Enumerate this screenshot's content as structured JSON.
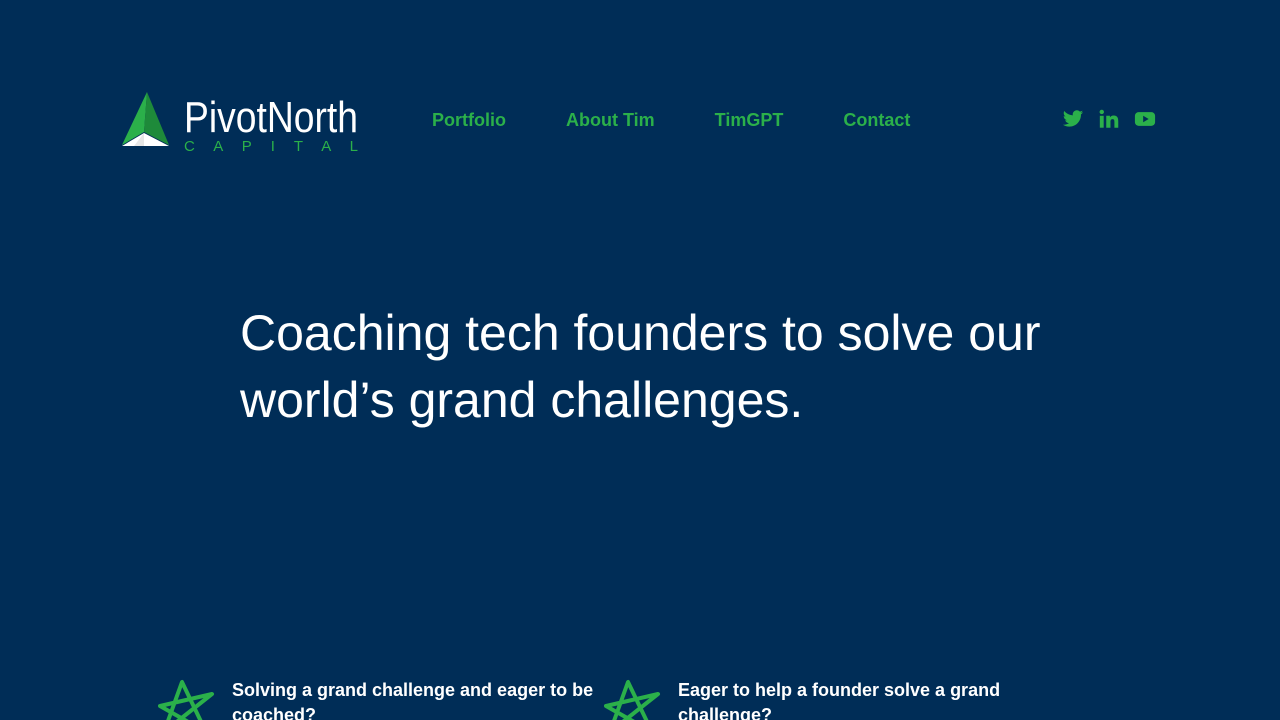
{
  "brand": {
    "name": "PivotNorth",
    "tagline": "C A P I T A L",
    "colors": {
      "background": "#002d57",
      "accent": "#2bb04a",
      "accent_dark": "#1e8a3a",
      "text": "#ffffff"
    }
  },
  "nav": {
    "items": [
      {
        "label": "Portfolio"
      },
      {
        "label": "About Tim"
      },
      {
        "label": "TimGPT"
      },
      {
        "label": "Contact"
      }
    ]
  },
  "social": {
    "icons": [
      "twitter-icon",
      "linkedin-icon",
      "youtube-icon"
    ]
  },
  "hero": {
    "headline": "Coaching tech founders to solve our world’s grand challenges."
  },
  "cta": {
    "items": [
      {
        "text": "Solving a grand challenge and eager to be coached?",
        "icon": "star-icon"
      },
      {
        "text": "Eager to help a founder solve a grand challenge?",
        "icon": "star-icon"
      }
    ]
  }
}
